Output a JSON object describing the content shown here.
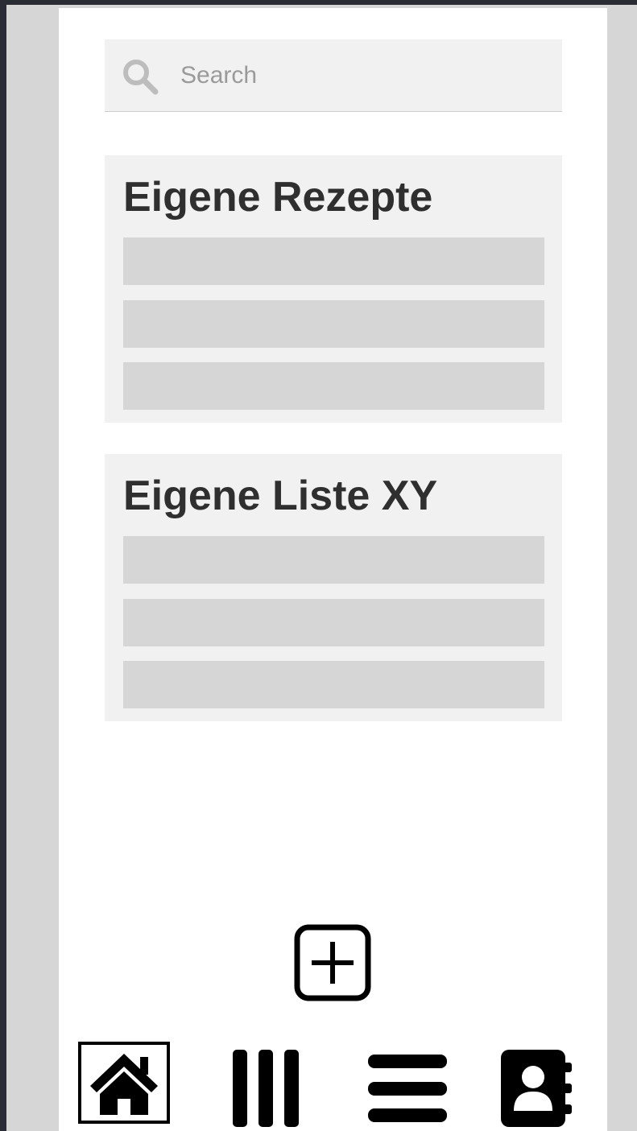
{
  "search": {
    "placeholder": "Search",
    "icon": "search-icon"
  },
  "lists": [
    {
      "title": "Eigene Rezepte",
      "items": [
        "",
        "",
        ""
      ]
    },
    {
      "title": "Eigene Liste XY",
      "items": [
        "",
        "",
        ""
      ]
    }
  ],
  "actions": {
    "add_icon": "plus-square-icon"
  },
  "bottom_nav": {
    "items": [
      {
        "icon": "home-icon",
        "active": true
      },
      {
        "icon": "library-icon",
        "active": false
      },
      {
        "icon": "menu-icon",
        "active": false
      },
      {
        "icon": "contacts-icon",
        "active": false
      }
    ]
  },
  "colors": {
    "background": "#d6d6d6",
    "surface": "#ffffff",
    "card": "#f1f1f1",
    "placeholder_row": "#d6d6d6",
    "title_text": "#2f2f2f",
    "icon": "#000000"
  }
}
